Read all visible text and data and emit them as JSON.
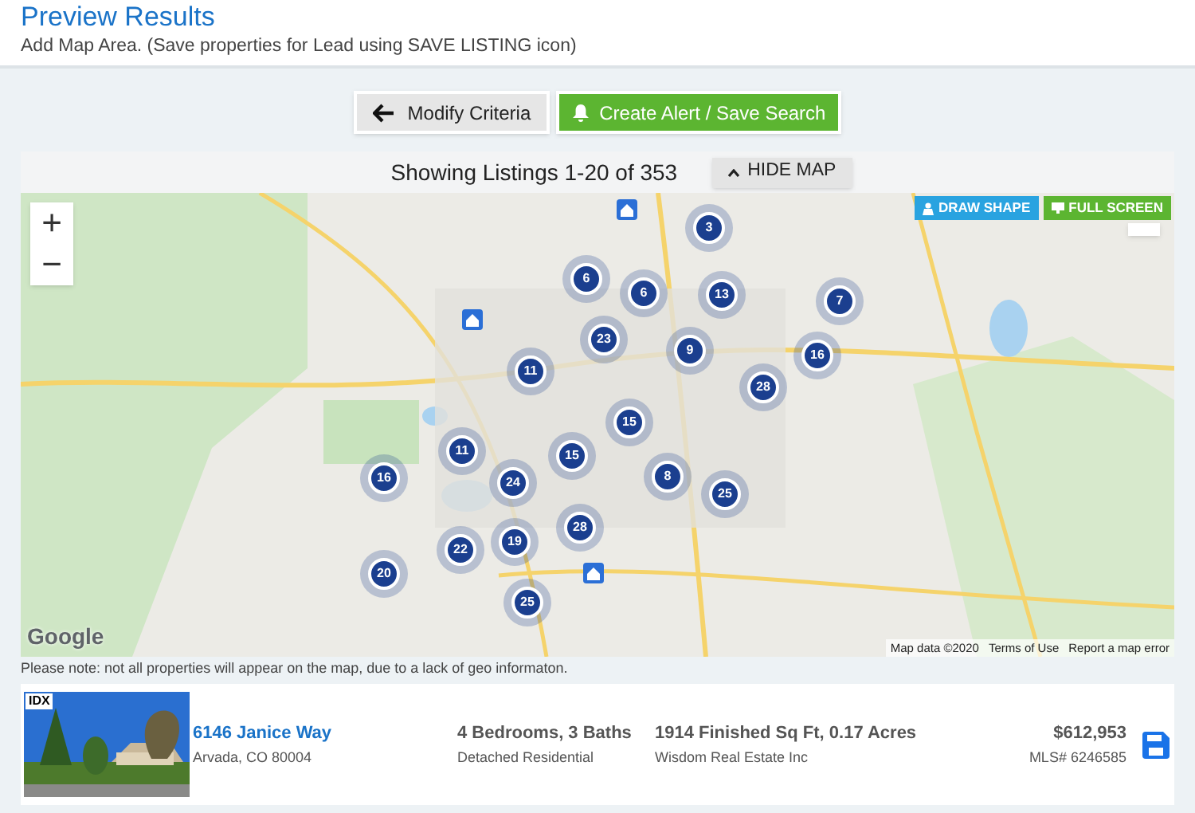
{
  "header": {
    "title": "Preview Results",
    "subtitle": "Add Map Area. (Save properties for Lead using SAVE LISTING icon)"
  },
  "actions": [
    {
      "kind": "back",
      "label": "Modify Criteria"
    },
    {
      "kind": "alert",
      "label": "Create Alert / Save Search"
    }
  ],
  "results": {
    "summary": "Showing Listings 1-20 of 353",
    "toggle": "HIDE MAP"
  },
  "map": {
    "zoom_in": "+",
    "zoom_out": "−",
    "tools": [
      {
        "kind": "draw",
        "label": "DRAW SHAPE"
      },
      {
        "kind": "fullscreen",
        "label": "FULL SCREEN"
      }
    ],
    "clusters": [
      "3",
      "6",
      "6",
      "13",
      "7",
      "23",
      "9",
      "16",
      "11",
      "28",
      "15",
      "11",
      "16",
      "24",
      "15",
      "8",
      "25",
      "28",
      "22",
      "19",
      "20",
      "25"
    ],
    "logo": "Google",
    "attribution": [
      "Map data ©2020",
      "Terms of Use",
      "Report a map error"
    ]
  },
  "note": "Please note: not all properties will appear on the map, due to a lack of geo informaton.",
  "listings": [
    {
      "badge": "IDX",
      "address": "6146 Janice Way",
      "city": "Arvada, CO 80004",
      "rooms": "4 Bedrooms, 3 Baths",
      "type": "Detached Residential",
      "size": "1914 Finished Sq Ft, 0.17 Acres",
      "office": "Wisdom Real Estate Inc",
      "price": "$612,953",
      "mls": "MLS# 6246585"
    }
  ]
}
